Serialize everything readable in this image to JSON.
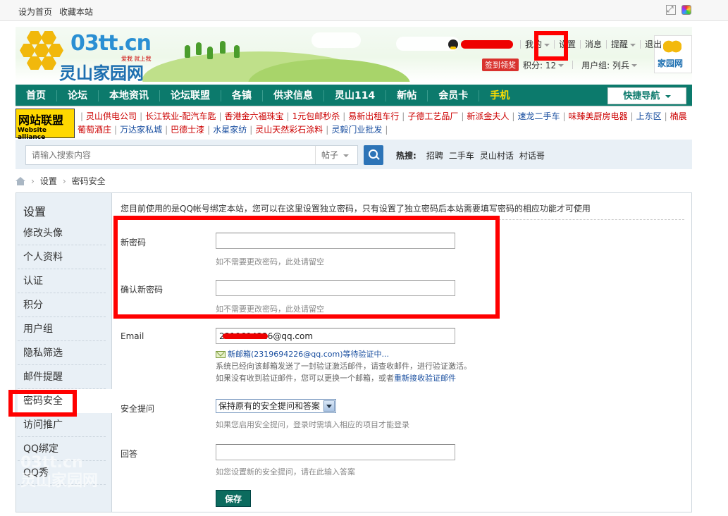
{
  "topbar": {
    "links": [
      "设为首页",
      "收藏本站"
    ]
  },
  "header": {
    "logo": {
      "domain": "03tt.cn",
      "tagline": "爱我 就上我",
      "site_name": "灵山家园网"
    },
    "user_menu": {
      "my": "我的",
      "settings": "设置",
      "messages": "消息",
      "reminders": "提醒",
      "logout": "退出"
    },
    "sign_in": "签到领奖",
    "points_label": "积分: 12",
    "user_group": "用户组: 列兵",
    "avatar_text": "家园网"
  },
  "nav": {
    "items": [
      "首页",
      "论坛",
      "本地资讯",
      "论坛联盟",
      "各镇",
      "供求信息",
      "灵山114",
      "新帖",
      "会员卡",
      "手机"
    ],
    "quick_nav": "快捷导航"
  },
  "alliance": {
    "badge_title": "网站联盟",
    "badge_sub": "Website alliance",
    "links": [
      {
        "text": "灵山供电公司",
        "color": "red"
      },
      {
        "text": "长江铁业-配汽车匙",
        "color": "red"
      },
      {
        "text": "香港金六福珠宝",
        "color": "red"
      },
      {
        "text": "1元包邮秒杀",
        "color": "red"
      },
      {
        "text": "易新出租车行",
        "color": "red"
      },
      {
        "text": "子德工艺品厂",
        "color": "red"
      },
      {
        "text": "新派金夫人",
        "color": "red"
      },
      {
        "text": "速龙二手车",
        "color": "blue"
      },
      {
        "text": "味臻美厨房电器",
        "color": "red"
      },
      {
        "text": "上东区",
        "color": "blue"
      },
      {
        "text": "楠晨葡萄酒庄",
        "color": "red"
      },
      {
        "text": "万达家私城",
        "color": "blue"
      },
      {
        "text": "巴德士漆",
        "color": "red"
      },
      {
        "text": "水星家纺",
        "color": "blue"
      },
      {
        "text": "灵山天然彩石涂料",
        "color": "red"
      },
      {
        "text": "灵毅门业批发",
        "color": "blue"
      }
    ]
  },
  "search": {
    "placeholder": "请输入搜索内容",
    "scope": "帖子",
    "hot_label": "热搜:",
    "hot_words": [
      "招聘",
      "二手车",
      "灵山村话",
      "村话哥"
    ]
  },
  "breadcrumb": [
    "设置",
    "密码安全"
  ],
  "sidebar": {
    "title": "设置",
    "items": [
      "修改头像",
      "个人资料",
      "认证",
      "积分",
      "用户组",
      "隐私筛选",
      "邮件提醒",
      "密码安全",
      "访问推广",
      "QQ绑定",
      "QQ秀"
    ],
    "active": "密码安全",
    "watermark_line1": "03tt.cn",
    "watermark_line2": "灵山家园网"
  },
  "form": {
    "notice": "您目前使用的是QQ帐号绑定本站，您可以在这里设置独立密码，只有设置了独立密码后本站需要填写密码的相应功能才可使用",
    "new_password_label": "新密码",
    "new_password_hint": "如不需要更改密码，此处请留空",
    "confirm_password_label": "确认新密码",
    "confirm_password_hint": "如不需要更改密码，此处请留空",
    "email_label": "Email",
    "email_value": "2319694226@qq.com",
    "email_pending": "新邮箱(2319694226@qq.com)等待验证中...",
    "email_note_1": "系统已经向该邮箱发送了一封验证激活邮件，请查收邮件，进行验证激活。",
    "email_note_2": "如果没有收到验证邮件，您可以更换一个邮箱，或者",
    "email_resend": "重新接收验证邮件",
    "security_label": "安全提问",
    "security_option": "保持原有的安全提问和答案",
    "security_hint": "如果您启用安全提问，登录时需填入相应的项目才能登录",
    "answer_label": "回答",
    "answer_hint": "如您设置新的安全提问，请在此输入答案",
    "save_label": "保存"
  }
}
